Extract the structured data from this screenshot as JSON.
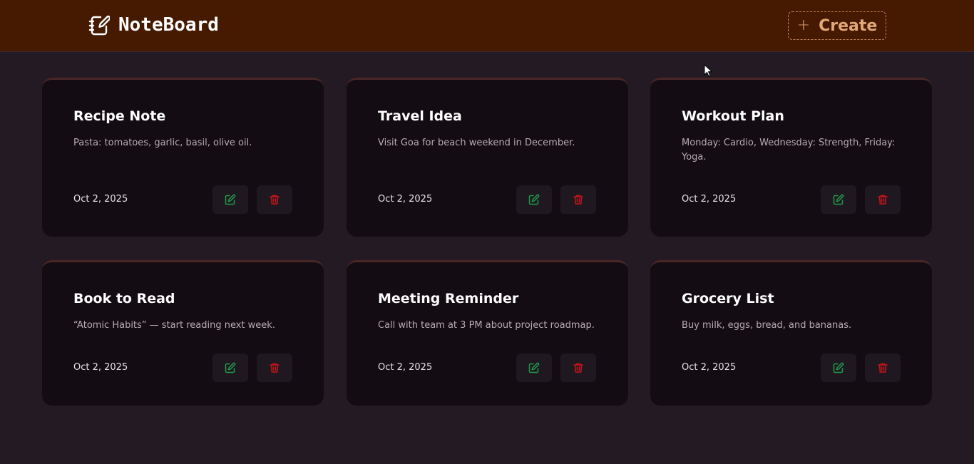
{
  "app": {
    "name": "NoteBoard",
    "create_label": "Create"
  },
  "notes": [
    {
      "title": "Recipe Note",
      "body": "Pasta: tomatoes, garlic, basil, olive oil.",
      "date": "Oct 2, 2025"
    },
    {
      "title": "Travel Idea",
      "body": "Visit Goa for beach weekend in December.",
      "date": "Oct 2, 2025"
    },
    {
      "title": "Workout Plan",
      "body": "Monday: Cardio, Wednesday: Strength, Friday: Yoga.",
      "date": "Oct 2, 2025"
    },
    {
      "title": "Book to Read",
      "body": "“Atomic Habits” — start reading next week.",
      "date": "Oct 2, 2025"
    },
    {
      "title": "Meeting Reminder",
      "body": "Call with team at 3 PM about project roadmap.",
      "date": "Oct 2, 2025"
    },
    {
      "title": "Grocery List",
      "body": "Buy milk, eggs, bread, and bananas.",
      "date": "Oct 2, 2025"
    }
  ],
  "icons": {
    "brand": "notebook-pen-icon",
    "create": "plus-icon",
    "edit": "edit-icon",
    "delete": "trash-icon"
  },
  "colors": {
    "header_bg": "#461901",
    "page_bg": "#241a24",
    "card_bg": "#130c13",
    "accent": "#e2a877",
    "edit": "#1f9a4a",
    "delete": "#c8151b"
  }
}
